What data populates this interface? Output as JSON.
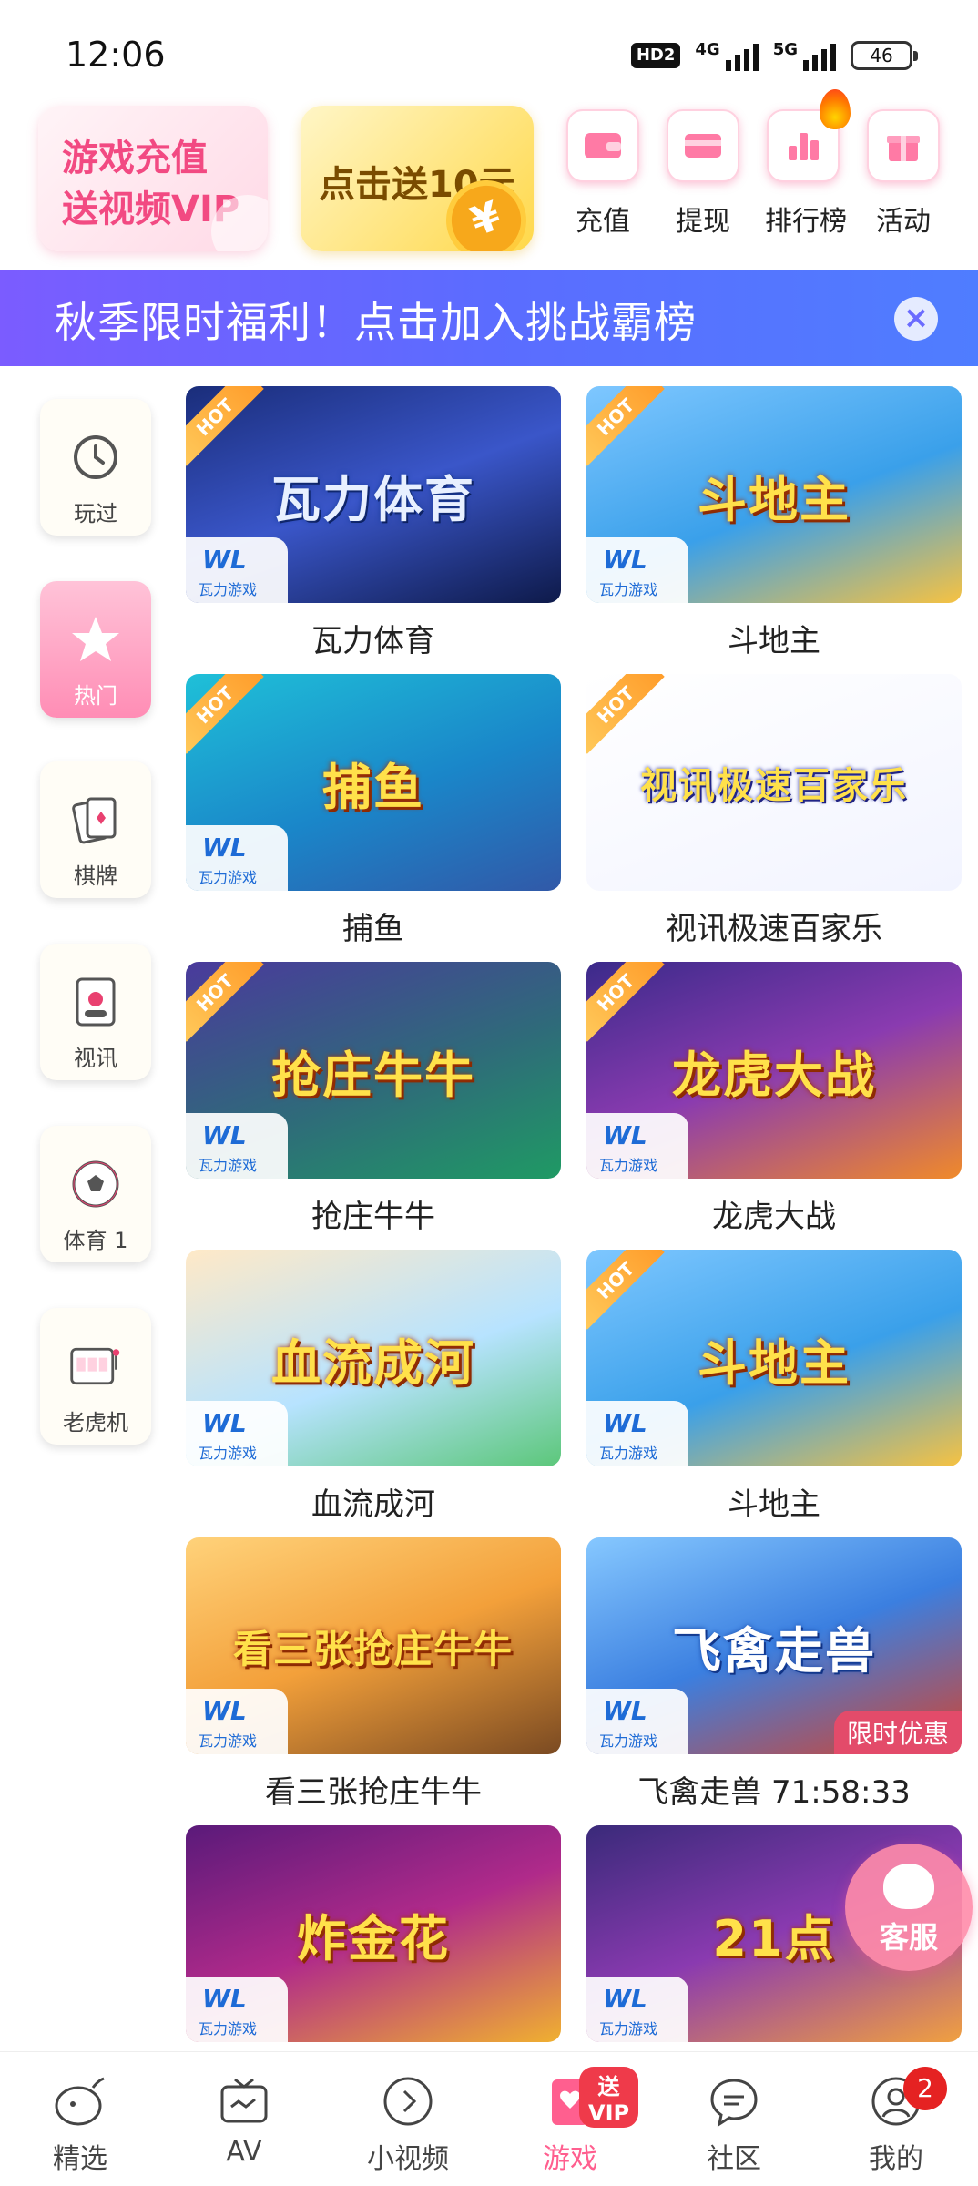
{
  "status_bar": {
    "time": "12:06",
    "hd": "HD2",
    "net1": "4G",
    "net2": "5G",
    "battery": "46"
  },
  "header": {
    "promo_vip": "游戏充值\n送视频VIP",
    "promo_cash": "点击送10元",
    "promo_cash_symbol": "¥",
    "quick_links": [
      {
        "label": "充值",
        "icon": "wallet-icon"
      },
      {
        "label": "提现",
        "icon": "card-icon"
      },
      {
        "label": "排行榜",
        "icon": "ranking-icon"
      },
      {
        "label": "活动",
        "icon": "gift-icon"
      }
    ]
  },
  "banner": {
    "text": "秋季限时福利！点击加入挑战霸榜",
    "close": "×"
  },
  "sidebar": {
    "items": [
      {
        "label": "玩过",
        "icon": "history-icon"
      },
      {
        "label": "热门",
        "icon": "star-icon"
      },
      {
        "label": "棋牌",
        "icon": "cards-icon"
      },
      {
        "label": "视讯",
        "icon": "video-icon"
      },
      {
        "label": "体育 1",
        "icon": "soccer-icon"
      },
      {
        "label": "老虎机",
        "icon": "slot-machine-icon"
      }
    ]
  },
  "games": {
    "hot_label": "HOT",
    "wl_logo": "WL",
    "wl_text": "瓦力游戏",
    "items": [
      {
        "name": "瓦力体育",
        "art": "瓦力体育",
        "hot": true
      },
      {
        "name": "斗地主",
        "art": "斗地主",
        "hot": true
      },
      {
        "name": "捕鱼",
        "art": "捕鱼",
        "hot": true
      },
      {
        "name": "视讯极速百家乐",
        "art": "视讯极速百家乐",
        "hot": true
      },
      {
        "name": "抢庄牛牛",
        "art": "抢庄牛牛",
        "hot": true
      },
      {
        "name": "龙虎大战",
        "art": "龙虎大战",
        "hot": true
      },
      {
        "name": "血流成河",
        "art": "血流成河",
        "hot": false
      },
      {
        "name": "斗地主",
        "art": "斗地主",
        "hot": true
      },
      {
        "name": "看三张抢庄牛牛",
        "art": "看三张抢庄牛牛",
        "hot": false
      },
      {
        "name": "飞禽走兽 71:58:33",
        "art": "飞禽走兽",
        "hot": false,
        "tag": "限时优惠"
      },
      {
        "name": "",
        "art": "炸金花",
        "hot": false
      },
      {
        "name": "",
        "art": "21点",
        "hot": false
      }
    ]
  },
  "service": {
    "label": "客服"
  },
  "tabbar": {
    "items": [
      {
        "label": "精选",
        "icon": "melon-icon"
      },
      {
        "label": "AV",
        "icon": "tv-icon"
      },
      {
        "label": "小视频",
        "icon": "play-circle-icon"
      },
      {
        "label": "游戏",
        "icon": "game-card-icon",
        "badge": "送VIP"
      },
      {
        "label": "社区",
        "icon": "chat-icon"
      },
      {
        "label": "我的",
        "icon": "profile-icon",
        "count": "2"
      }
    ]
  },
  "colors": {
    "accent_pink": "#ff5f8f",
    "banner_purple": "#6b64ff",
    "gold": "#ffd84a"
  }
}
